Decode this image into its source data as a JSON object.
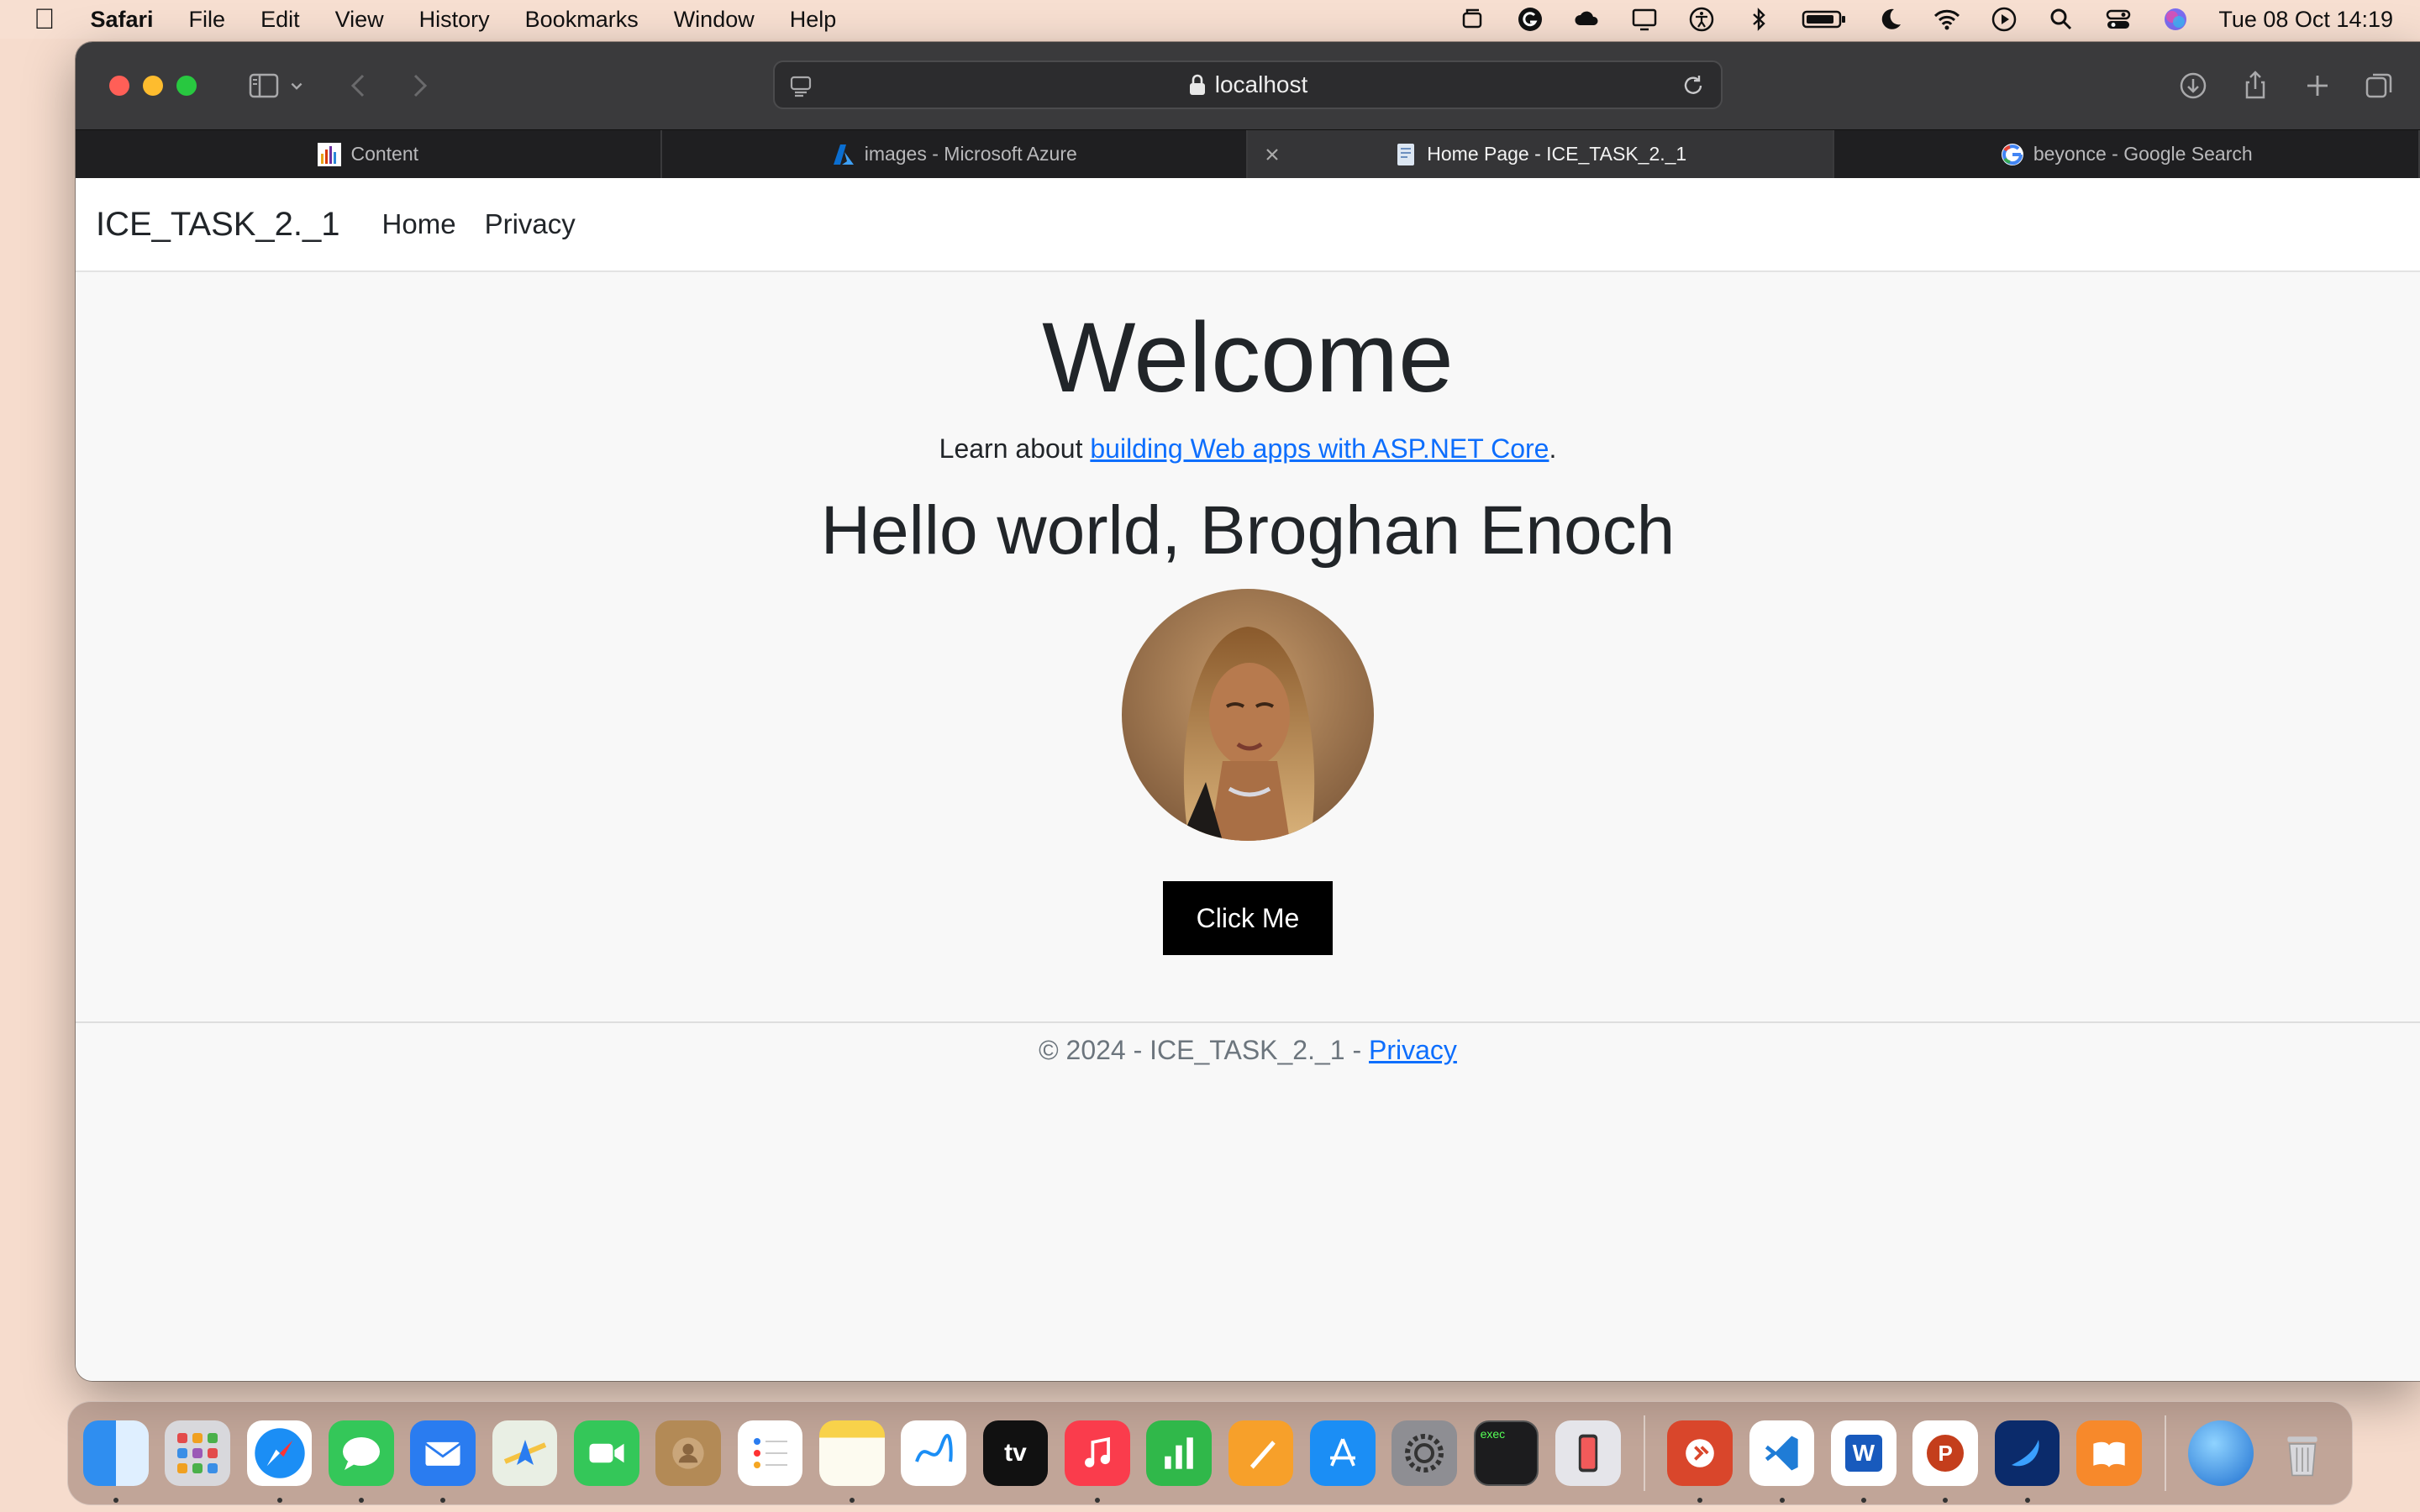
{
  "menubar": {
    "app_name": "Safari",
    "menus": [
      "File",
      "Edit",
      "View",
      "History",
      "Bookmarks",
      "Window",
      "Help"
    ],
    "clock": "Tue 08 Oct  14:19"
  },
  "browser": {
    "address": "localhost",
    "tabs": [
      {
        "label": "Content",
        "active": false
      },
      {
        "label": "images - Microsoft Azure",
        "active": false
      },
      {
        "label": "Home Page - ICE_TASK_2._1",
        "active": true
      },
      {
        "label": "beyonce - Google Search",
        "active": false
      }
    ]
  },
  "site": {
    "brand": "ICE_TASK_2._1",
    "nav": [
      "Home",
      "Privacy"
    ],
    "heading": "Welcome",
    "learn_prefix": "Learn about ",
    "learn_link": "building Web apps with ASP.NET Core",
    "learn_suffix": ".",
    "hello": "Hello world, Broghan Enoch",
    "button": "Click Me",
    "footer_prefix": "© 2024 - ICE_TASK_2._1 - ",
    "footer_link": "Privacy"
  },
  "dock": {
    "apps": [
      "finder-icon",
      "launchpad-icon",
      "safari-icon",
      "messages-icon",
      "mail-icon",
      "maps-icon",
      "facetime-icon",
      "contacts-icon",
      "reminders-icon",
      "notes-icon",
      "freeform-icon",
      "tv-icon",
      "music-icon",
      "numbers-icon",
      "pages-icon",
      "app-store-icon",
      "system-settings-icon",
      "terminal-icon",
      "iphone-mirroring-icon",
      "remote-desktop-icon",
      "vscode-icon",
      "word-icon",
      "powerpoint-icon",
      "swift-icon",
      "books-icon",
      "globe-icon",
      "trash-icon"
    ],
    "tv_label": "tv",
    "terminal_label": "exec",
    "word_label": "W",
    "powerpoint_label": "P"
  },
  "colors": {
    "link": "#0d6efd",
    "button_bg": "#000000",
    "toolbar": "#3a3a3c"
  }
}
